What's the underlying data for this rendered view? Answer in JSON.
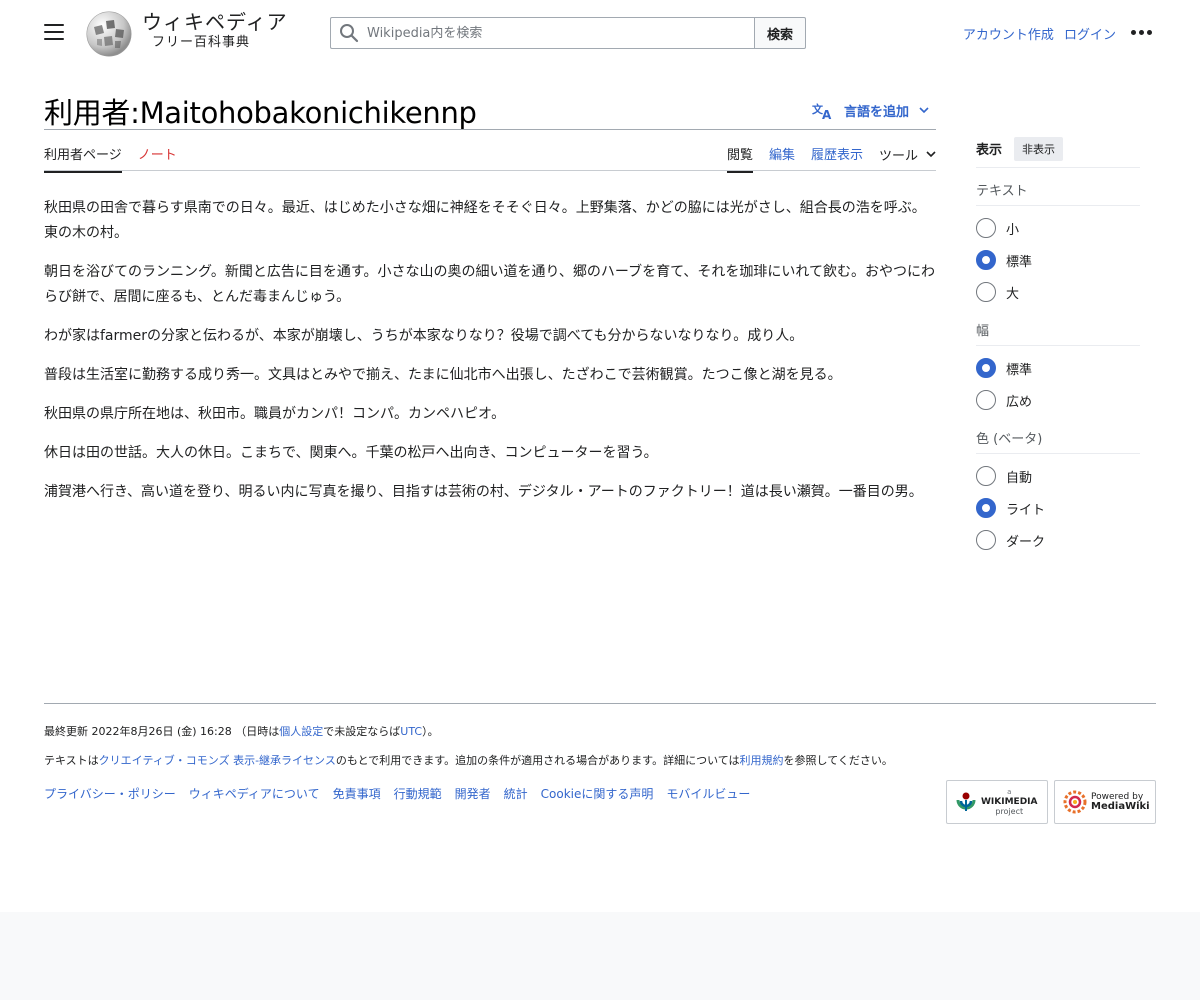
{
  "header": {
    "logo_wordmark": "ウィキペディア",
    "logo_tagline": "フリー百科事典",
    "search_placeholder": "Wikipedia内を検索",
    "search_button": "検索",
    "create_account": "アカウント作成",
    "login": "ログイン"
  },
  "page": {
    "title": "利用者:Maitohobakonichikennp",
    "add_languages": "言語を追加"
  },
  "tabs": {
    "left": [
      "利用者ページ",
      "ノート"
    ],
    "right": [
      "閲覧",
      "編集",
      "履歴表示",
      "ツール"
    ]
  },
  "content": {
    "paragraphs": [
      "秋田県の田舎で暮らす県南での日々。最近、はじめた小さな畑に神経をそそぐ日々。上野集落、かどの脇には光がさし、組合長の浩を呼ぶ。東の木の村。",
      "朝日を浴びてのランニング。新聞と広告に目を通す。小さな山の奥の細い道を通り、郷のハーブを育て、それを珈琲にいれて飲む。おやつにわらび餅で、居間に座るも、とんだ毒まんじゅう。",
      "わが家はfarmerの分家と伝わるが、本家が崩壊し、うちが本家なりなり？役場で調べても分からないなりなり。成り人。",
      "普段は生活室に勤務する成り秀一。文具はとみやで揃え、たまに仙北市へ出張し、たざわこで芸術観賞。たつこ像と湖を見る。",
      "秋田県の県庁所在地は、秋田市。職員がカンパ！コンパ。カンペハピオ。",
      "休日は田の世話。大人の休日。こまちで、関東へ。千葉の松戸へ出向き、コンピューターを習う。",
      "浦賀港へ行き、高い道を登り、明るい内に写真を撮り、目指すは芸術の村、デジタル・アートのファクトリー！道は長い瀬賀。一番目の男。"
    ]
  },
  "appearance": {
    "title": "表示",
    "hide": "非表示",
    "text_label": "テキスト",
    "text_options": [
      "小",
      "標準",
      "大"
    ],
    "text_selected": "標準",
    "width_label": "幅",
    "width_options": [
      "標準",
      "広め"
    ],
    "width_selected": "標準",
    "color_label": "色 (ベータ)",
    "color_options": [
      "自動",
      "ライト",
      "ダーク"
    ],
    "color_selected": "ライト"
  },
  "footer": {
    "last_modified_prefix": "最終更新 2022年8月26日 (金) 16:28 （日時は",
    "personal_settings": "個人設定",
    "last_modified_mid": "で未設定ならば",
    "utc": "UTC",
    "last_modified_suffix": "）。",
    "license_prefix": "テキストは",
    "license_link": "クリエイティブ・コモンズ 表示-継承ライセンス",
    "license_mid": "のもとで利用できます。追加の条件が適用される場合があります。詳細については",
    "terms_link": "利用規約",
    "license_suffix": "を参照してください。",
    "places": [
      "プライバシー・ポリシー",
      "ウィキペディアについて",
      "免責事項",
      "行動規範",
      "開発者",
      "統計",
      "Cookieに関する声明",
      "モバイルビュー"
    ],
    "wikimedia_badge_small": "a",
    "wikimedia_badge_name": "WIKIMEDIA",
    "wikimedia_badge_sub": "project",
    "mediawiki_badge_line1": "Powered by",
    "mediawiki_badge_line2": "MediaWiki"
  },
  "colors": {
    "link": "#3366cc",
    "redlink": "#d73333",
    "text": "#202122",
    "border": "#a2a9b1"
  },
  "icons": [
    "menu-icon",
    "wikipedia-globe-icon",
    "search-icon",
    "more-dots-icon",
    "translate-icon",
    "chevron-down-icon",
    "wikimedia-logo-icon",
    "mediawiki-logo-icon"
  ]
}
